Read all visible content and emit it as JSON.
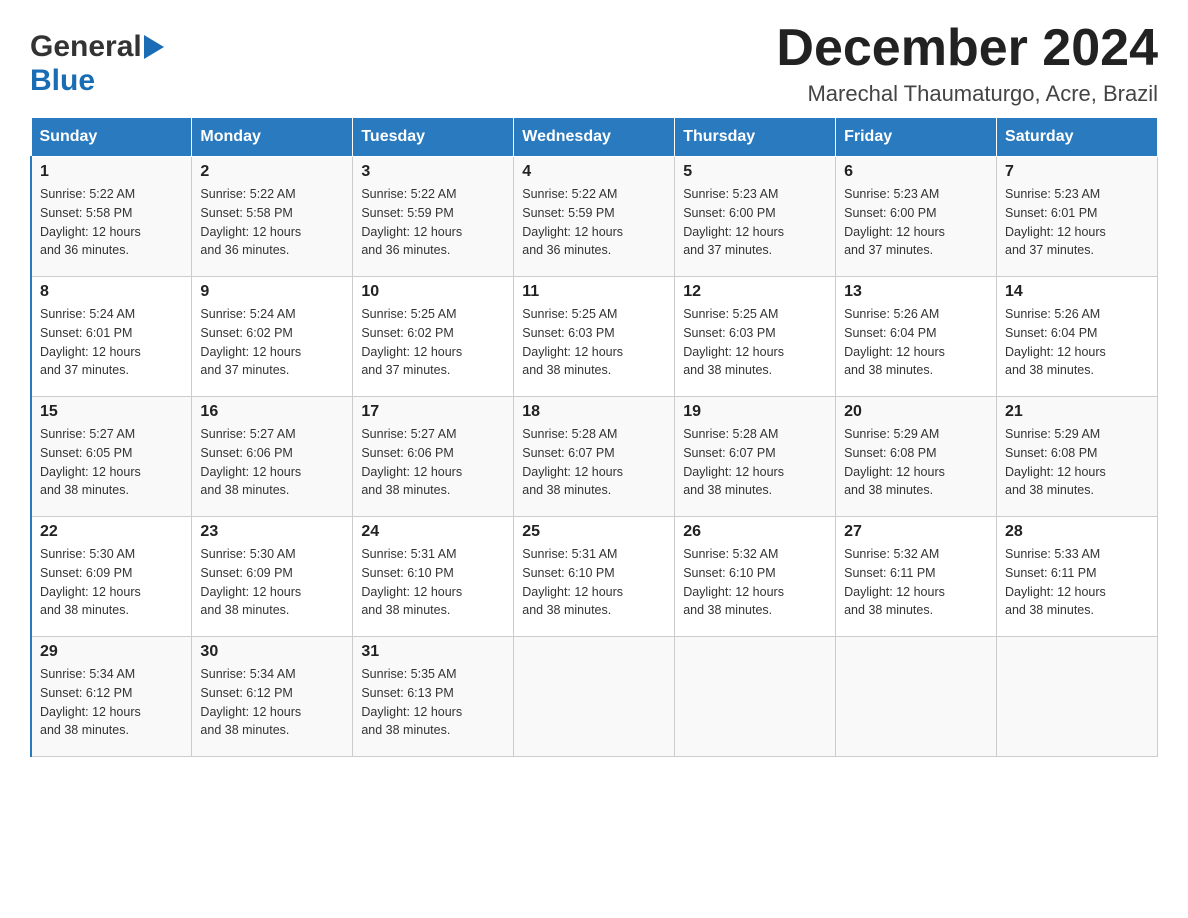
{
  "header": {
    "logo_general": "General",
    "logo_blue": "Blue",
    "month_title": "December 2024",
    "location": "Marechal Thaumaturgo, Acre, Brazil"
  },
  "weekdays": [
    "Sunday",
    "Monday",
    "Tuesday",
    "Wednesday",
    "Thursday",
    "Friday",
    "Saturday"
  ],
  "weeks": [
    [
      {
        "day": "1",
        "sunrise": "5:22 AM",
        "sunset": "5:58 PM",
        "daylight": "12 hours and 36 minutes."
      },
      {
        "day": "2",
        "sunrise": "5:22 AM",
        "sunset": "5:58 PM",
        "daylight": "12 hours and 36 minutes."
      },
      {
        "day": "3",
        "sunrise": "5:22 AM",
        "sunset": "5:59 PM",
        "daylight": "12 hours and 36 minutes."
      },
      {
        "day": "4",
        "sunrise": "5:22 AM",
        "sunset": "5:59 PM",
        "daylight": "12 hours and 36 minutes."
      },
      {
        "day": "5",
        "sunrise": "5:23 AM",
        "sunset": "6:00 PM",
        "daylight": "12 hours and 37 minutes."
      },
      {
        "day": "6",
        "sunrise": "5:23 AM",
        "sunset": "6:00 PM",
        "daylight": "12 hours and 37 minutes."
      },
      {
        "day": "7",
        "sunrise": "5:23 AM",
        "sunset": "6:01 PM",
        "daylight": "12 hours and 37 minutes."
      }
    ],
    [
      {
        "day": "8",
        "sunrise": "5:24 AM",
        "sunset": "6:01 PM",
        "daylight": "12 hours and 37 minutes."
      },
      {
        "day": "9",
        "sunrise": "5:24 AM",
        "sunset": "6:02 PM",
        "daylight": "12 hours and 37 minutes."
      },
      {
        "day": "10",
        "sunrise": "5:25 AM",
        "sunset": "6:02 PM",
        "daylight": "12 hours and 37 minutes."
      },
      {
        "day": "11",
        "sunrise": "5:25 AM",
        "sunset": "6:03 PM",
        "daylight": "12 hours and 38 minutes."
      },
      {
        "day": "12",
        "sunrise": "5:25 AM",
        "sunset": "6:03 PM",
        "daylight": "12 hours and 38 minutes."
      },
      {
        "day": "13",
        "sunrise": "5:26 AM",
        "sunset": "6:04 PM",
        "daylight": "12 hours and 38 minutes."
      },
      {
        "day": "14",
        "sunrise": "5:26 AM",
        "sunset": "6:04 PM",
        "daylight": "12 hours and 38 minutes."
      }
    ],
    [
      {
        "day": "15",
        "sunrise": "5:27 AM",
        "sunset": "6:05 PM",
        "daylight": "12 hours and 38 minutes."
      },
      {
        "day": "16",
        "sunrise": "5:27 AM",
        "sunset": "6:06 PM",
        "daylight": "12 hours and 38 minutes."
      },
      {
        "day": "17",
        "sunrise": "5:27 AM",
        "sunset": "6:06 PM",
        "daylight": "12 hours and 38 minutes."
      },
      {
        "day": "18",
        "sunrise": "5:28 AM",
        "sunset": "6:07 PM",
        "daylight": "12 hours and 38 minutes."
      },
      {
        "day": "19",
        "sunrise": "5:28 AM",
        "sunset": "6:07 PM",
        "daylight": "12 hours and 38 minutes."
      },
      {
        "day": "20",
        "sunrise": "5:29 AM",
        "sunset": "6:08 PM",
        "daylight": "12 hours and 38 minutes."
      },
      {
        "day": "21",
        "sunrise": "5:29 AM",
        "sunset": "6:08 PM",
        "daylight": "12 hours and 38 minutes."
      }
    ],
    [
      {
        "day": "22",
        "sunrise": "5:30 AM",
        "sunset": "6:09 PM",
        "daylight": "12 hours and 38 minutes."
      },
      {
        "day": "23",
        "sunrise": "5:30 AM",
        "sunset": "6:09 PM",
        "daylight": "12 hours and 38 minutes."
      },
      {
        "day": "24",
        "sunrise": "5:31 AM",
        "sunset": "6:10 PM",
        "daylight": "12 hours and 38 minutes."
      },
      {
        "day": "25",
        "sunrise": "5:31 AM",
        "sunset": "6:10 PM",
        "daylight": "12 hours and 38 minutes."
      },
      {
        "day": "26",
        "sunrise": "5:32 AM",
        "sunset": "6:10 PM",
        "daylight": "12 hours and 38 minutes."
      },
      {
        "day": "27",
        "sunrise": "5:32 AM",
        "sunset": "6:11 PM",
        "daylight": "12 hours and 38 minutes."
      },
      {
        "day": "28",
        "sunrise": "5:33 AM",
        "sunset": "6:11 PM",
        "daylight": "12 hours and 38 minutes."
      }
    ],
    [
      {
        "day": "29",
        "sunrise": "5:34 AM",
        "sunset": "6:12 PM",
        "daylight": "12 hours and 38 minutes."
      },
      {
        "day": "30",
        "sunrise": "5:34 AM",
        "sunset": "6:12 PM",
        "daylight": "12 hours and 38 minutes."
      },
      {
        "day": "31",
        "sunrise": "5:35 AM",
        "sunset": "6:13 PM",
        "daylight": "12 hours and 38 minutes."
      },
      null,
      null,
      null,
      null
    ]
  ],
  "labels": {
    "sunrise": "Sunrise:",
    "sunset": "Sunset:",
    "daylight": "Daylight:"
  }
}
